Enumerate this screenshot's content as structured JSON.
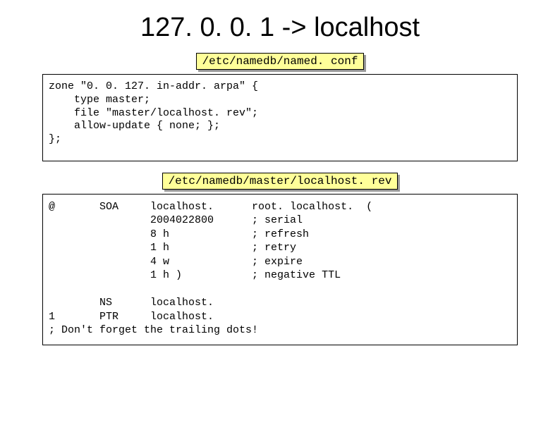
{
  "title": "127. 0. 0. 1 -> localhost",
  "label1": "/etc/namedb/named. conf",
  "code1": "zone \"0. 0. 127. in-addr. arpa\" {\n    type master;\n    file \"master/localhost. rev\";\n    allow-update { none; };\n};",
  "label2": "/etc/namedb/master/localhost. rev",
  "code2": "@       SOA     localhost.      root. localhost.  (\n                2004022800      ; serial\n                8 h             ; refresh\n                1 h             ; retry\n                4 w             ; expire\n                1 h )           ; negative TTL\n\n        NS      localhost.\n1       PTR     localhost.\n; Don't forget the trailing dots!"
}
